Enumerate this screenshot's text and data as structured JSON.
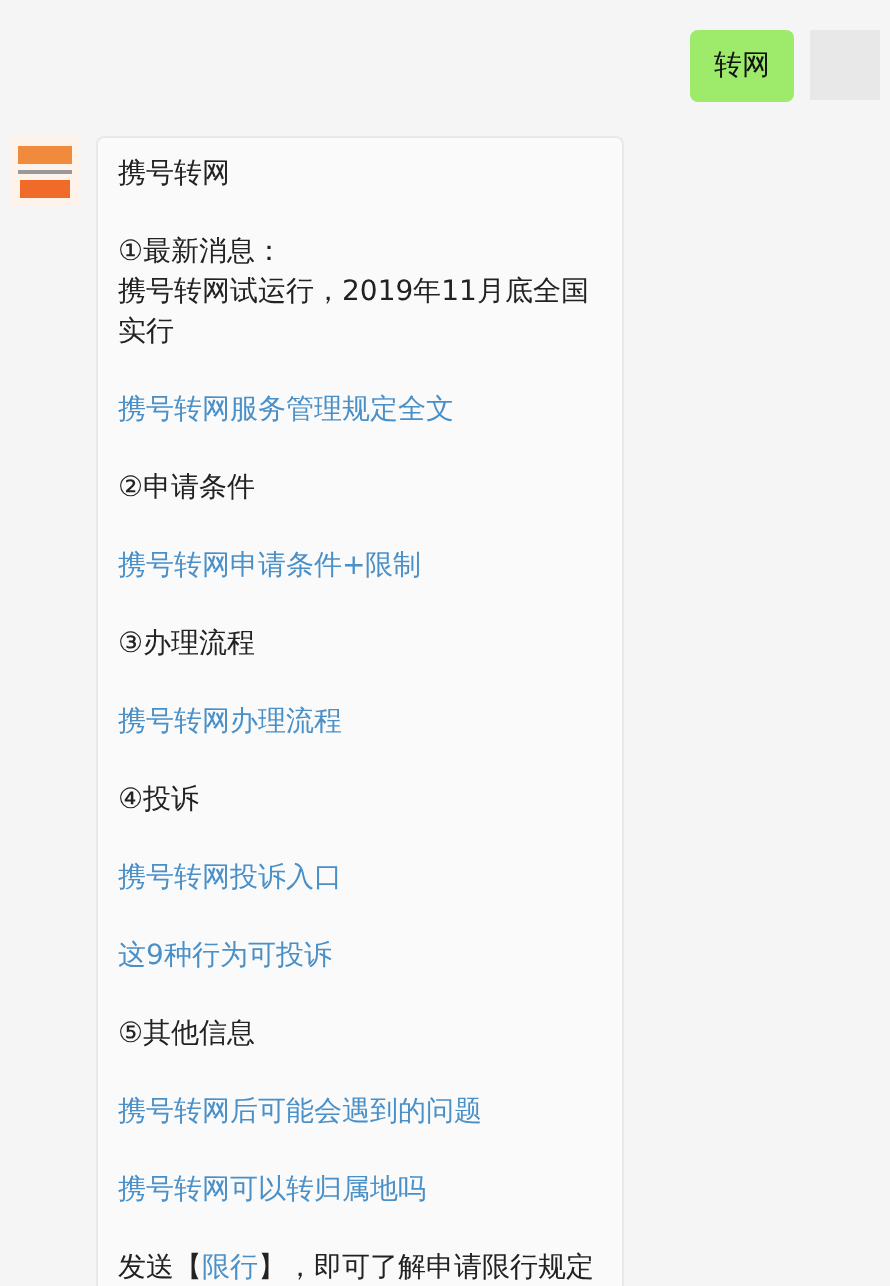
{
  "messages": [
    {
      "kind": "outgoing",
      "paragraphs": [
        {
          "segments": [
            {
              "kind": "text",
              "text": "转网"
            }
          ]
        }
      ]
    },
    {
      "kind": "incoming",
      "paragraphs": [
        {
          "segments": [
            {
              "kind": "text",
              "text": "携号转网"
            }
          ]
        },
        {
          "segments": [
            {
              "kind": "line",
              "text": "①最新消息："
            },
            {
              "kind": "line",
              "text": "携号转网试运行，2019年11月底全国实行"
            }
          ]
        },
        {
          "segments": [
            {
              "kind": "link",
              "text": "携号转网服务管理规定全文"
            }
          ]
        },
        {
          "segments": [
            {
              "kind": "text",
              "text": "②申请条件"
            }
          ]
        },
        {
          "segments": [
            {
              "kind": "link",
              "text": "携号转网申请条件+限制"
            }
          ]
        },
        {
          "segments": [
            {
              "kind": "text",
              "text": "③办理流程"
            }
          ]
        },
        {
          "segments": [
            {
              "kind": "link",
              "text": "携号转网办理流程"
            }
          ]
        },
        {
          "segments": [
            {
              "kind": "text",
              "text": "④投诉"
            }
          ]
        },
        {
          "segments": [
            {
              "kind": "link",
              "text": "携号转网投诉入口"
            }
          ]
        },
        {
          "segments": [
            {
              "kind": "link",
              "text": "这9种行为可投诉"
            }
          ]
        },
        {
          "segments": [
            {
              "kind": "text",
              "text": "⑤其他信息"
            }
          ]
        },
        {
          "segments": [
            {
              "kind": "link",
              "text": "携号转网后可能会遇到的问题"
            }
          ]
        },
        {
          "segments": [
            {
              "kind": "link",
              "text": "携号转网可以转归属地吗"
            }
          ]
        },
        {
          "segments": [
            {
              "kind": "text",
              "text": "发送【"
            },
            {
              "kind": "link",
              "text": "限行"
            },
            {
              "kind": "text",
              "text": "】，即可了解申请限行规定"
            }
          ]
        }
      ]
    }
  ]
}
